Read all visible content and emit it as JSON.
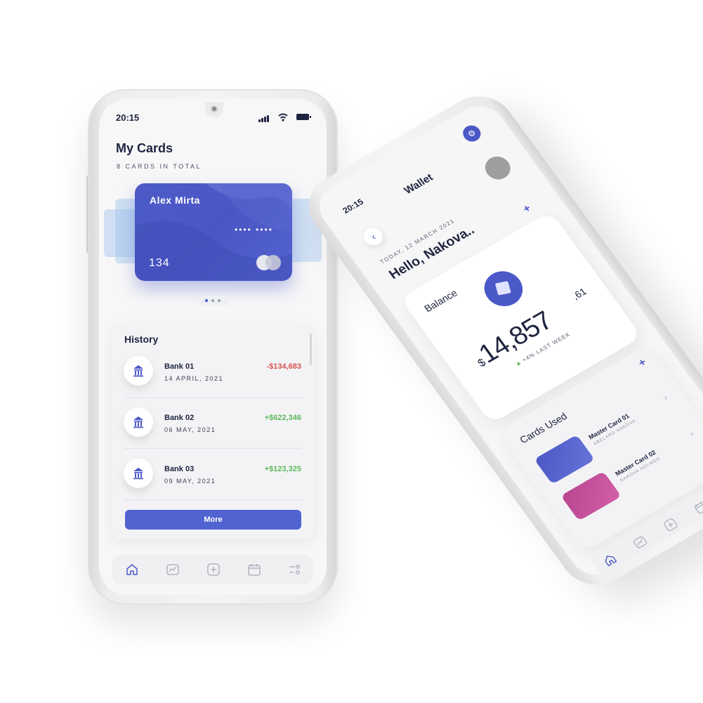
{
  "colors": {
    "accent": "#4b58c7",
    "negative": "#d9534f",
    "positive": "#5cb85c",
    "text": "#1f2440"
  },
  "phone_left": {
    "status_time": "20:15",
    "title": "My Cards",
    "subtitle": "8 CARDS IN TOTAL",
    "card": {
      "holder": "Alex Mirta",
      "masked": "•••• ••••",
      "number": "134"
    },
    "history": {
      "title": "History",
      "items": [
        {
          "name": "Bank 01",
          "date": "14 APRIL, 2021",
          "amount": "-$134,683",
          "type": "negative"
        },
        {
          "name": "Bank 02",
          "date": "06 MAY, 2021",
          "amount": "+$622,346",
          "type": "positive"
        },
        {
          "name": "Bank 03",
          "date": "09 MAY, 2021",
          "amount": "+$123,325",
          "type": "positive"
        }
      ],
      "more_label": "More"
    },
    "nav_icons": [
      "home-icon",
      "chart-icon",
      "plus-square-icon",
      "calendar-icon",
      "settings-sliders-icon"
    ]
  },
  "phone_right": {
    "status_time": "20:15",
    "title": "Wallet",
    "date_line": "TODAY, 12 MARCH 2021",
    "greeting": "Hello, Nakova..",
    "balance": {
      "label": "Balance",
      "currency": "$",
      "amount": "14,857",
      "cents": ",61",
      "change": "+4% LAST WEEK"
    },
    "cards_used": {
      "title": "Cards Used",
      "items": [
        {
          "name": "Master Card 01",
          "sub": "ABELARD NAKOVA"
        },
        {
          "name": "Master Card 02",
          "sub": "NAKOVA NOLWEN"
        }
      ]
    }
  }
}
